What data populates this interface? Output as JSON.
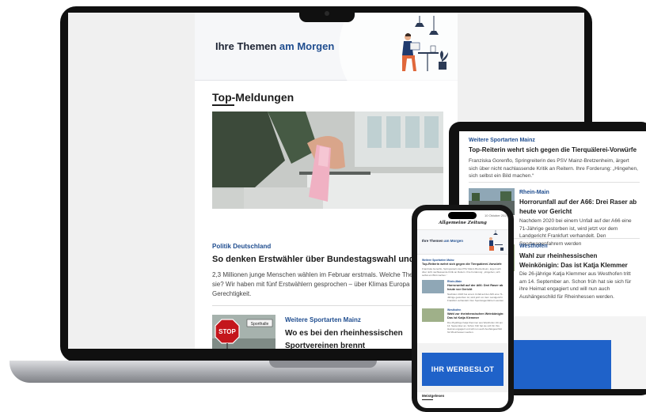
{
  "laptop": {
    "newsletter": {
      "title_main": "Ihre Themen ",
      "title_accent": "am Morgen",
      "section": "Top-Meldungen",
      "lead_kicker": "Politik Deutschland",
      "lead_headline": "So denken Erstwähler über Bundestagswahl und Poli",
      "lead_body": "2,3 Millionen junge Menschen wählen im Februar erstmals. Welche Them bewegen sie? Wir haben mit fünf Erstwählern gesprochen – über Klimas Europa und soziale Gerechtigkeit.",
      "second_kicker": "Weitere Sportarten Mainz",
      "second_headline": "Wo es bei den rheinhessischen Sportvereinen brennt",
      "thumb_sign_text": "STOP",
      "thumb_street_text": "Sporthalle"
    }
  },
  "tablet": {
    "article1": {
      "kicker": "Weitere Sportarten Mainz",
      "headline": "Top-Reiterin wehrt sich gegen die Tierquälerei-Vorwürfe",
      "body": "Franziska Gorenflo, Springreiterin des PSV Mainz-Bretzenheim, ärgert sich über nicht nachlassende Kritik an Reitern. Ihre Forderung: „Hingehen, sich selbst ein Bild machen.“"
    },
    "article2": {
      "kicker": "Rhein-Main",
      "headline": "Horrorunfall auf der A66: Drei Raser ab heute vor Gericht",
      "body": "Nachdem 2020 bei einem Unfall auf der A66 eine 71-Jährige gestorben ist, wird jetzt vor dem Landgericht Frankfurt verhandelt. Den Sportwagenfahrern werden"
    },
    "article3": {
      "kicker": "Westhofen",
      "headline": "Wahl zur rheinhessischen Weinkönigin: Das ist Katja Klemmer",
      "body": "Die 26-jährige Katja Klemmer aus Westhofen tritt am 14. September an. Schon früh hat sie sich für ihre Heimat engagiert und will nun auch Aushängeschild für Rheinhessen werden."
    }
  },
  "phone": {
    "status_time": "10 Oktober 2024",
    "logo": "Allgemeine Zeitung",
    "title_main": "Ihre Themen ",
    "title_accent": "am Morgen",
    "a1_kicker": "Weitere Sportarten Mainz",
    "a1_headline": "Top-Reiterin wehrt sich gegen die Tierquälerei-Vorwürfe",
    "a1_body": "Franziska Gorenflo, Springreiterin des PSV Mainz-Bretzenheim, ärgert sich über nicht nachlassende Kritik an Reitern. Ihre Forderung: „Hingehen, sich selbst ein Bild machen.“",
    "a2_kicker": "Rhein-Main",
    "a2_headline": "Horrorunfall auf der A66: Drei Raser ab heute vor Gericht",
    "a2_body": "Nachdem 2020 bei einem Unfall auf der A66 eine 71-Jährige gestorben ist, wird jetzt vor dem Landgericht Frankfurt verhandelt. Den Sportwagenfahrern werden",
    "a3_kicker": "Westhofen",
    "a3_headline": "Wahl zur rheinhessischen Weinkönigin: Das ist Katja Klemmer",
    "a3_body": "Die 26-jährige Katja Klemmer aus Westhofen tritt am 14. September an. Schon früh hat sie sich für ihre Heimat engagiert und will nun auch Aushängeschild für Rheinhessen werden.",
    "ad_text": "IHR WERBESLOT",
    "footer": "Meistgelesen"
  },
  "colors": {
    "accent_blue": "#1f4d8f",
    "ad_blue": "#1f62c9"
  }
}
